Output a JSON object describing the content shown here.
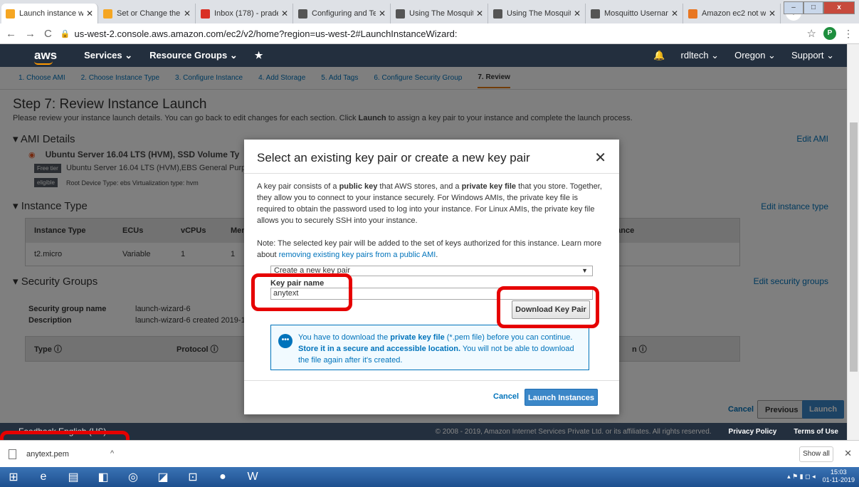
{
  "browser": {
    "tabs": [
      {
        "title": "Launch instance wiza",
        "active": true,
        "icon": "aws-cube-icon",
        "color": "#f5a623"
      },
      {
        "title": "Set or Change the R",
        "active": false,
        "icon": "aws-cube-icon",
        "color": "#f5a623"
      },
      {
        "title": "Inbox (178) - pradee",
        "active": false,
        "icon": "gmail-icon",
        "color": "#d93025"
      },
      {
        "title": "Configuring and Test",
        "active": false,
        "icon": "globe-icon",
        "color": "#555"
      },
      {
        "title": "Using The Mosquitto",
        "active": false,
        "icon": "globe-icon",
        "color": "#555"
      },
      {
        "title": "Using The Mosquitto",
        "active": false,
        "icon": "globe-icon",
        "color": "#555"
      },
      {
        "title": "Mosquitto Usernam",
        "active": false,
        "icon": "globe-icon",
        "color": "#555"
      },
      {
        "title": "Amazon ec2 not wor",
        "active": false,
        "icon": "stack-icon",
        "color": "#e87722"
      }
    ],
    "url": "us-west-2.console.aws.amazon.com/ec2/v2/home?region=us-west-2#LaunchInstanceWizard:",
    "profile_initial": "P"
  },
  "awsnav": {
    "logo": "aws",
    "services": "Services ⌄",
    "resource_groups": "Resource Groups ⌄",
    "user": "rdltech ⌄",
    "region": "Oregon ⌄",
    "support": "Support ⌄"
  },
  "wizard": {
    "steps": [
      "1. Choose AMI",
      "2. Choose Instance Type",
      "3. Configure Instance",
      "4. Add Storage",
      "5. Add Tags",
      "6. Configure Security Group",
      "7. Review"
    ],
    "title": "Step 7: Review Instance Launch",
    "description_pre": "Please review your instance launch details. You can go back to edit changes for each section. Click ",
    "description_bold": "Launch",
    "description_post": " to assign a key pair to your instance and complete the launch process."
  },
  "ami": {
    "header": "AMI Details",
    "edit": "Edit AMI",
    "name": "Ubuntu Server 16.04 LTS (HVM), SSD Volume Ty",
    "line2": "Ubuntu Server 16.04 LTS (HVM),EBS General Purpose (SS",
    "line3": "Root Device Type: ebs    Virtualization type: hvm",
    "badge1": "Free tier",
    "badge2": "eligible"
  },
  "instance_type": {
    "header": "Instance Type",
    "edit": "Edit instance type",
    "columns": [
      "Instance Type",
      "ECUs",
      "vCPUs",
      "Mer"
    ],
    "row": [
      "t2.micro",
      "Variable",
      "1",
      "1"
    ],
    "perf_col": "Performance",
    "perf_val": "loderate"
  },
  "security": {
    "header": "Security Groups",
    "edit": "Edit security groups",
    "name_label": "Security group name",
    "name_value": "launch-wizard-6",
    "desc_label": "Description",
    "desc_value": "launch-wizard-6 created 2019-11",
    "columns": [
      "Type ⓘ",
      "Protocol ⓘ"
    ],
    "right_col": "n ⓘ"
  },
  "bottom_buttons": {
    "cancel": "Cancel",
    "previous": "Previous",
    "launch": "Launch"
  },
  "footer": {
    "lang": "Feedback   English (US)",
    "copyright": "© 2008 - 2019, Amazon Internet Services Private Ltd. or its affiliates. All rights reserved.",
    "privacy": "Privacy Policy",
    "terms": "Terms of Use"
  },
  "modal": {
    "title": "Select an existing key pair or create a new key pair",
    "p1_a": "A key pair consists of a ",
    "p1_b": "public key",
    "p1_c": " that AWS stores, and a ",
    "p1_d": "private key file",
    "p1_e": " that you store. Together, they allow you to connect to your instance securely. For Windows AMIs, the private key file is required to obtain the password used to log into your instance. For Linux AMIs, the private key file allows you to securely SSH into your instance.",
    "p2_a": "Note: The selected key pair will be added to the set of keys authorized for this instance. Learn more about ",
    "p2_link": "removing existing key pairs from a public AMI",
    "p2_b": ".",
    "select_value": "Create a new key pair",
    "key_label": "Key pair name",
    "key_value": "anytext",
    "download": "Download Key Pair",
    "info_a": "You have to download the ",
    "info_b": "private key file",
    "info_c": " (*.pem file) before you can continue. ",
    "info_d": "Store it in a secure and accessible location.",
    "info_e": " You will not be able to download the file again after it's created.",
    "cancel": "Cancel",
    "launch": "Launch Instances"
  },
  "download_bar": {
    "file": "anytext.pem",
    "show_all": "Show all"
  },
  "taskbar": {
    "time": "15:03",
    "date": "01-11-2019"
  }
}
